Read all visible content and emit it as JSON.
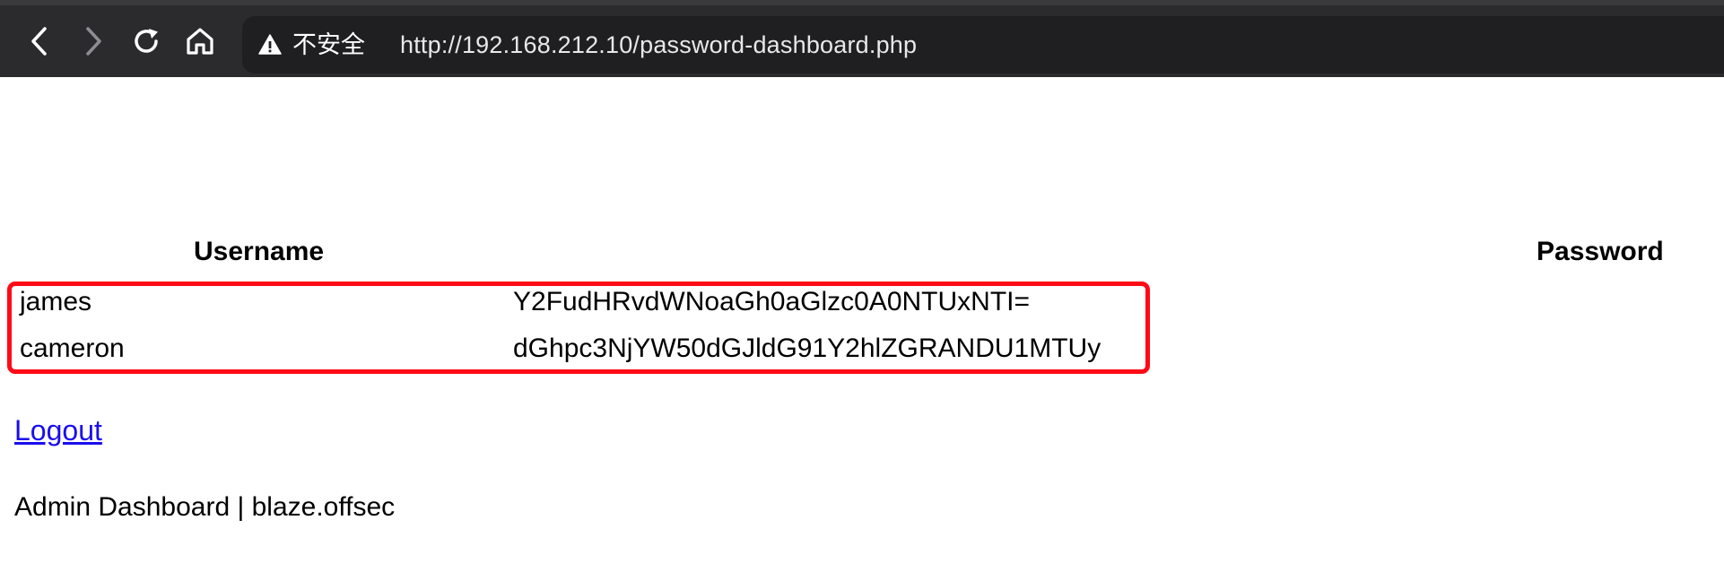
{
  "browser": {
    "security_label": "不安全",
    "url": "http://192.168.212.10/password-dashboard.php"
  },
  "table": {
    "headers": [
      "Username",
      "Password"
    ],
    "rows": [
      {
        "username": "james",
        "password": "Y2FudHRvdWNoaGh0aGlzc0A0NTUxNTI="
      },
      {
        "username": "cameron",
        "password": "dGhpc3NjYW50dGJldG91Y2hlZGRANDU1MTUy"
      }
    ]
  },
  "logout_label": "Logout",
  "footer_text": "Admin Dashboard | blaze.offsec",
  "colors": {
    "highlight": "#ff0a16",
    "link": "#1a0dee",
    "toolbar": "#2b2b2e"
  }
}
